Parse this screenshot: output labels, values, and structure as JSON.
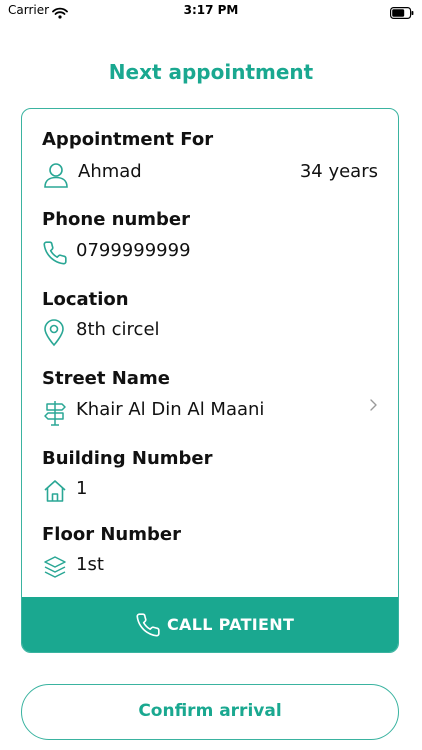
{
  "status_bar": {
    "carrier": "Carrier",
    "time": "3:17 PM"
  },
  "page": {
    "title": "Next appointment"
  },
  "colors": {
    "accent": "#1aa890",
    "border": "#3ab3a0",
    "icon": "#2aa795"
  },
  "appointment": {
    "for_label": "Appointment For",
    "patient_name": "Ahmad",
    "patient_age": "34 years",
    "phone_label": "Phone number",
    "phone": "0799999999",
    "location_label": "Location",
    "location": "8th circel",
    "street_label": "Street Name",
    "street": "Khair Al Din Al Maani",
    "building_label": "Building Number",
    "building": "1",
    "floor_label": "Floor Number",
    "floor": "1st"
  },
  "icons": {
    "patient": "user-icon",
    "phone": "phone-icon",
    "location": "map-pin-icon",
    "street": "signpost-icon",
    "building": "home-icon",
    "floor": "layers-icon",
    "street_action": "chevron-right-icon"
  },
  "actions": {
    "call_label": "CALL PATIENT",
    "confirm_label": "Confirm arrival"
  }
}
